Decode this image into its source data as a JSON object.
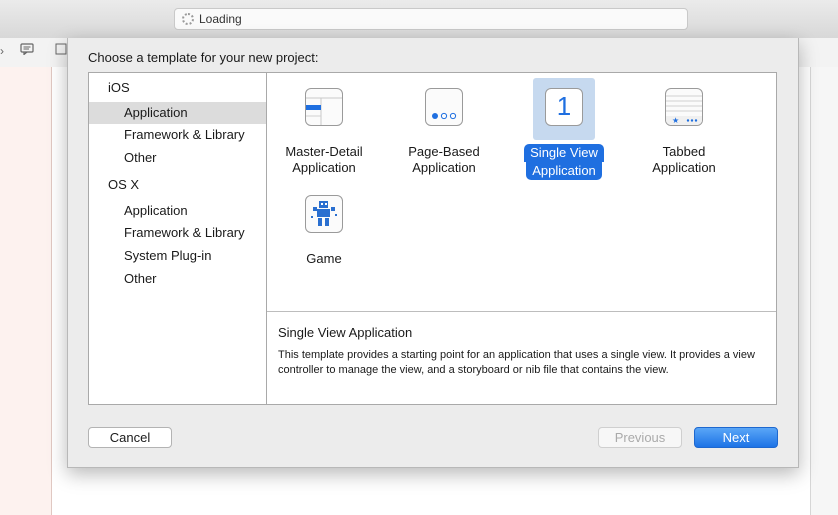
{
  "activity": {
    "status": "Loading"
  },
  "dialog": {
    "title": "Choose a template for your new project:"
  },
  "sidebar": {
    "items": [
      {
        "label": "iOS",
        "kind": "header"
      },
      {
        "label": "Application",
        "kind": "item",
        "selected": true
      },
      {
        "label": "Framework & Library",
        "kind": "item"
      },
      {
        "label": "Other",
        "kind": "item"
      },
      {
        "label": "OS X",
        "kind": "header"
      },
      {
        "label": "Application",
        "kind": "item"
      },
      {
        "label": "Framework & Library",
        "kind": "item"
      },
      {
        "label": "System Plug-in",
        "kind": "item"
      },
      {
        "label": "Other",
        "kind": "item"
      }
    ]
  },
  "templates": [
    {
      "line1": "Master-Detail",
      "line2": "Application",
      "icon": "master-detail-icon"
    },
    {
      "line1": "Page-Based",
      "line2": "Application",
      "icon": "page-based-icon"
    },
    {
      "line1": "Single View",
      "line2": "Application",
      "icon": "single-view-icon",
      "glyph": "1",
      "selected": true
    },
    {
      "line1": "Tabbed",
      "line2": "Application",
      "icon": "tabbed-icon"
    },
    {
      "line1": "Game",
      "line2": "",
      "icon": "game-icon"
    }
  ],
  "description": {
    "title": "Single View Application",
    "text": "This template provides a starting point for an application that uses a single view. It provides a view controller to manage the view, and a storyboard or nib file that contains the view."
  },
  "buttons": {
    "cancel": "Cancel",
    "previous": "Previous",
    "next": "Next"
  },
  "colors": {
    "selection_blue": "#1f6fe0",
    "selection_highlight": "#c6d9ef",
    "sidebar_selection": "#dcdcdc"
  }
}
